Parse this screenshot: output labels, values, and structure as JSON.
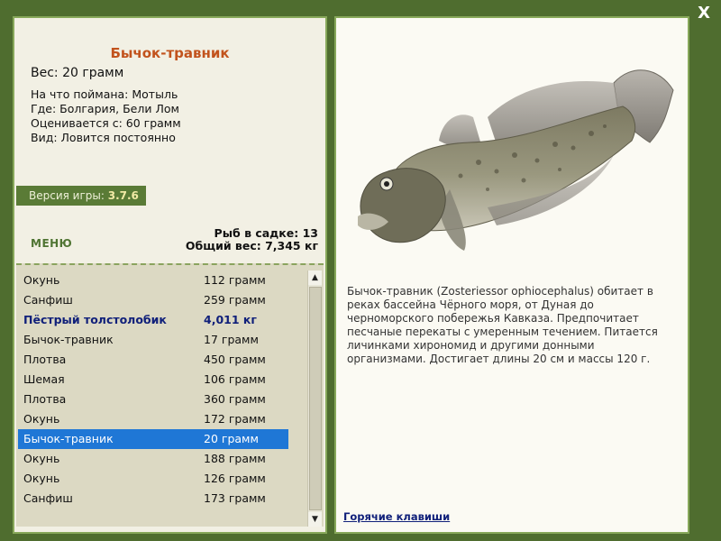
{
  "close_label": "X",
  "fish": {
    "title": "Бычок-травник",
    "weight": "Вес: 20 грамм",
    "bait": "На что поймана: Мотыль",
    "place": "Где: Болгария, Бели Лом",
    "valued": "Оценивается с: 60 грамм",
    "kind": "Вид: Ловится постоянно",
    "description": "Бычок-травник (Zosteriessor ophiocephalus) обитает в реках бассейна Чёрного моря, от Дуная до черноморского побережья Кавказа. Предпочитает песчаные перекаты с умеренным течением. Питается личинками хирономид и другими донными организмами. Достигает длины 20 см и массы 120 г."
  },
  "version": {
    "label": "Версия игры:",
    "value": "3.7.6"
  },
  "menu_label": "МЕНЮ",
  "net": {
    "count": "Рыб в садке: 13",
    "total": "Общий вес: 7,345 кг"
  },
  "list": [
    {
      "name": "Окунь",
      "weight": "112 грамм"
    },
    {
      "name": "Санфиш",
      "weight": "259 грамм"
    },
    {
      "name": "Пёстрый толстолобик",
      "weight": "4,011 кг"
    },
    {
      "name": "Бычок-травник",
      "weight": "17 грамм"
    },
    {
      "name": "Плотва",
      "weight": "450 грамм"
    },
    {
      "name": "Шемая",
      "weight": "106 грамм"
    },
    {
      "name": "Плотва",
      "weight": "360 грамм"
    },
    {
      "name": "Окунь",
      "weight": "172 грамм"
    },
    {
      "name": "Бычок-травник",
      "weight": "20 грамм"
    },
    {
      "name": "Окунь",
      "weight": "188 грамм"
    },
    {
      "name": "Окунь",
      "weight": "126 грамм"
    },
    {
      "name": "Санфиш",
      "weight": "173 грамм"
    }
  ],
  "hotkeys_label": "Горячие клавиши",
  "colors": {
    "background": "#4f6d2f",
    "title": "#c2531d",
    "selected": "#1f77d6",
    "special": "#10207a"
  }
}
